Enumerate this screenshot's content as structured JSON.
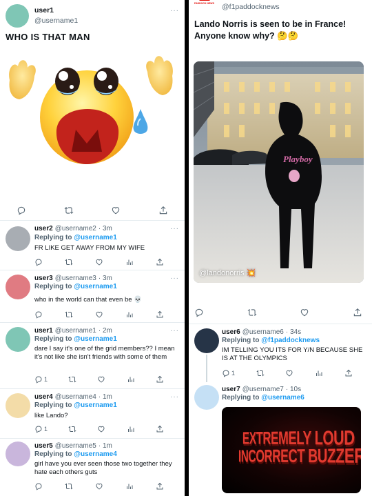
{
  "left": {
    "main_tweet": {
      "name": "user1",
      "handle": "@username1",
      "text": "WHO IS THAT MAN",
      "image_icon": "crying-face-emoji",
      "avatar_color": "#7fc6b5"
    },
    "replies": [
      {
        "name": "user2",
        "handle": "@username2",
        "time": "· 3m",
        "replying_label": "Replying to",
        "replying_to": "@username1",
        "text": "FR LIKE GET AWAY FROM MY WIFE",
        "avatar_color": "#a8adb3",
        "reply_count": "",
        "like_count": ""
      },
      {
        "name": "user3",
        "handle": "@username3",
        "time": "· 3m",
        "replying_label": "Replying to",
        "replying_to": "@username1",
        "text": "who in the world can that even be 💀",
        "avatar_color": "#e07b82",
        "reply_count": "",
        "like_count": ""
      },
      {
        "name": "user1",
        "handle": "@username1",
        "time": "· 2m",
        "replying_label": "Replying to",
        "replying_to": "@username1",
        "text": "dare I say it's one of the grid members?? I mean it's not like she isn't friends with some of them",
        "avatar_color": "#7fc6b5",
        "reply_count": "1",
        "like_count": ""
      },
      {
        "name": "user4",
        "handle": "@username4",
        "time": "· 1m",
        "replying_label": "Replying to",
        "replying_to": "@username1",
        "text": "like Lando?",
        "avatar_color": "#f3dca8",
        "reply_count": "1",
        "like_count": ""
      },
      {
        "name": "user5",
        "handle": "@username5",
        "time": "· 1m",
        "replying_label": "Replying to",
        "replying_to": "@username4",
        "text": "girl have you ever seen those two together they hate each others guts",
        "avatar_color": "#c9b6dc",
        "reply_count": "",
        "like_count": ""
      }
    ]
  },
  "right": {
    "main_tweet": {
      "handle": "@f1paddocknews",
      "logo_text": "PADDOCK NEWS",
      "text": "Lando Norris is seen to be in France! Anyone know why? 🤔🤔",
      "photo_watermark": "@landonorris 💥",
      "hoodie_text": "Playboy"
    },
    "replies": [
      {
        "name": "user6",
        "handle": "@username6",
        "time": "· 34s",
        "replying_label": "Replying to",
        "replying_to": "@f1paddocknews",
        "text": "IM TELLING YOU ITS FOR Y/N BECAUSE SHE IS AT THE OLYMPICS",
        "avatar_color": "#263447",
        "reply_count": "1"
      },
      {
        "name": "user7",
        "handle": "@username7",
        "time": "· 10s",
        "replying_label": "Replying to",
        "replying_to": "@username6",
        "avatar_color": "#c5e0f5",
        "gif_text_1": "EXTREMELY LOUD",
        "gif_text_2": "INCORRECT BUZZER"
      }
    ]
  },
  "icons": [
    "reply-icon",
    "retweet-icon",
    "like-icon",
    "analytics-icon",
    "share-icon",
    "more-icon"
  ]
}
